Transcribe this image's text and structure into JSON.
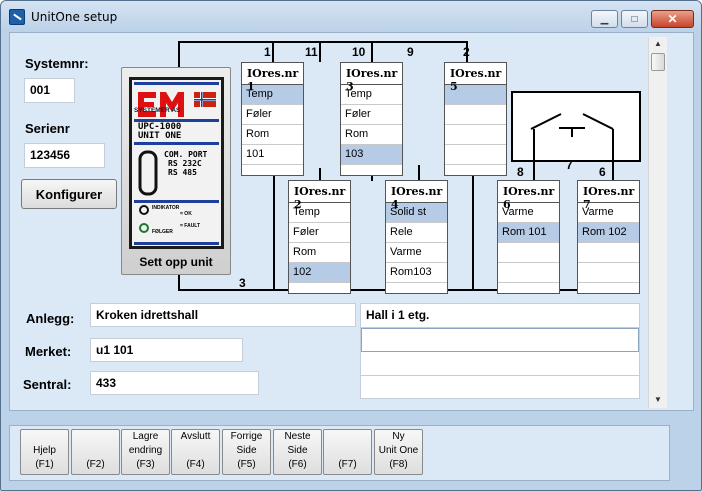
{
  "window": {
    "title": "UnitOne setup"
  },
  "left": {
    "systemnr_label": "Systemnr:",
    "systemnr_value": "001",
    "serienr_label": "Serienr",
    "serienr_value": "123456",
    "konfigurer_label": "Konfigurer"
  },
  "unit": {
    "caption": "Sett opp unit",
    "brand": "SYSTEMER AS",
    "model_line1": "UPC-1000",
    "model_line2": "UNIT ONE",
    "com_port": "COM. PORT",
    "rs232": "RS 232C",
    "rs485": "RS 485",
    "indicator": "INDIKATOR",
    "ok": "= OK",
    "fault": "= FAULT",
    "folger": "FØLGER"
  },
  "iores": [
    {
      "title": "IOres.nr 1",
      "rows": [
        "Temp",
        "Føler",
        "Rom",
        "101",
        ""
      ],
      "selected": 0
    },
    {
      "title": "IOres.nr 2",
      "rows": [
        "Temp",
        "Føler",
        "Rom",
        "102",
        ""
      ],
      "selected": 3
    },
    {
      "title": "IOres.nr 3",
      "rows": [
        "Temp",
        "Føler",
        "Rom",
        "103",
        ""
      ],
      "selected": 3
    },
    {
      "title": "IOres.nr 4",
      "rows": [
        "Solid st",
        "Rele",
        "Varme",
        "Rom103",
        ""
      ],
      "selected": 0
    },
    {
      "title": "IOres.nr 5",
      "rows": [
        "",
        "",
        "",
        "",
        ""
      ],
      "selected": 0
    },
    {
      "title": "IOres.nr 6",
      "rows": [
        "Varme",
        "Rom 101",
        "",
        "",
        ""
      ],
      "selected": 1
    },
    {
      "title": "IOres.nr 7",
      "rows": [
        "Varme",
        "Rom 102",
        "",
        "",
        ""
      ],
      "selected": 1
    }
  ],
  "wire_numbers": {
    "n1": "1",
    "n11": "11",
    "n10": "10",
    "n9": "9",
    "n2": "2",
    "n3": "3",
    "n8": "8",
    "n7": "7",
    "n6": "6"
  },
  "bottom": {
    "anlegg_label": "Anlegg:",
    "anlegg_value": "Kroken idrettshall",
    "merket_label": "Merket:",
    "merket_value": "u1 101",
    "sentral_label": "Sentral:",
    "sentral_value": "433",
    "notes_lines": [
      "Hall i 1 etg.",
      "",
      "",
      ""
    ]
  },
  "fkeys": [
    {
      "line1": "",
      "line2": "Hjelp",
      "line3": "(F1)"
    },
    {
      "line1": "",
      "line2": "",
      "line3": "(F2)"
    },
    {
      "line1": "Lagre",
      "line2": "endring",
      "line3": "(F3)"
    },
    {
      "line1": "Avslutt",
      "line2": "",
      "line3": "(F4)"
    },
    {
      "line1": "Forrige",
      "line2": "Side",
      "line3": "(F5)"
    },
    {
      "line1": "Neste",
      "line2": "Side",
      "line3": "(F6)"
    },
    {
      "line1": "",
      "line2": "",
      "line3": "(F7)"
    },
    {
      "line1": "Ny",
      "line2": "Unit One",
      "line3": "(F8)"
    }
  ],
  "colors": {
    "accent": "#b5cbe6",
    "panel": "#dbe8f6",
    "frame": "#bcd2e8"
  }
}
